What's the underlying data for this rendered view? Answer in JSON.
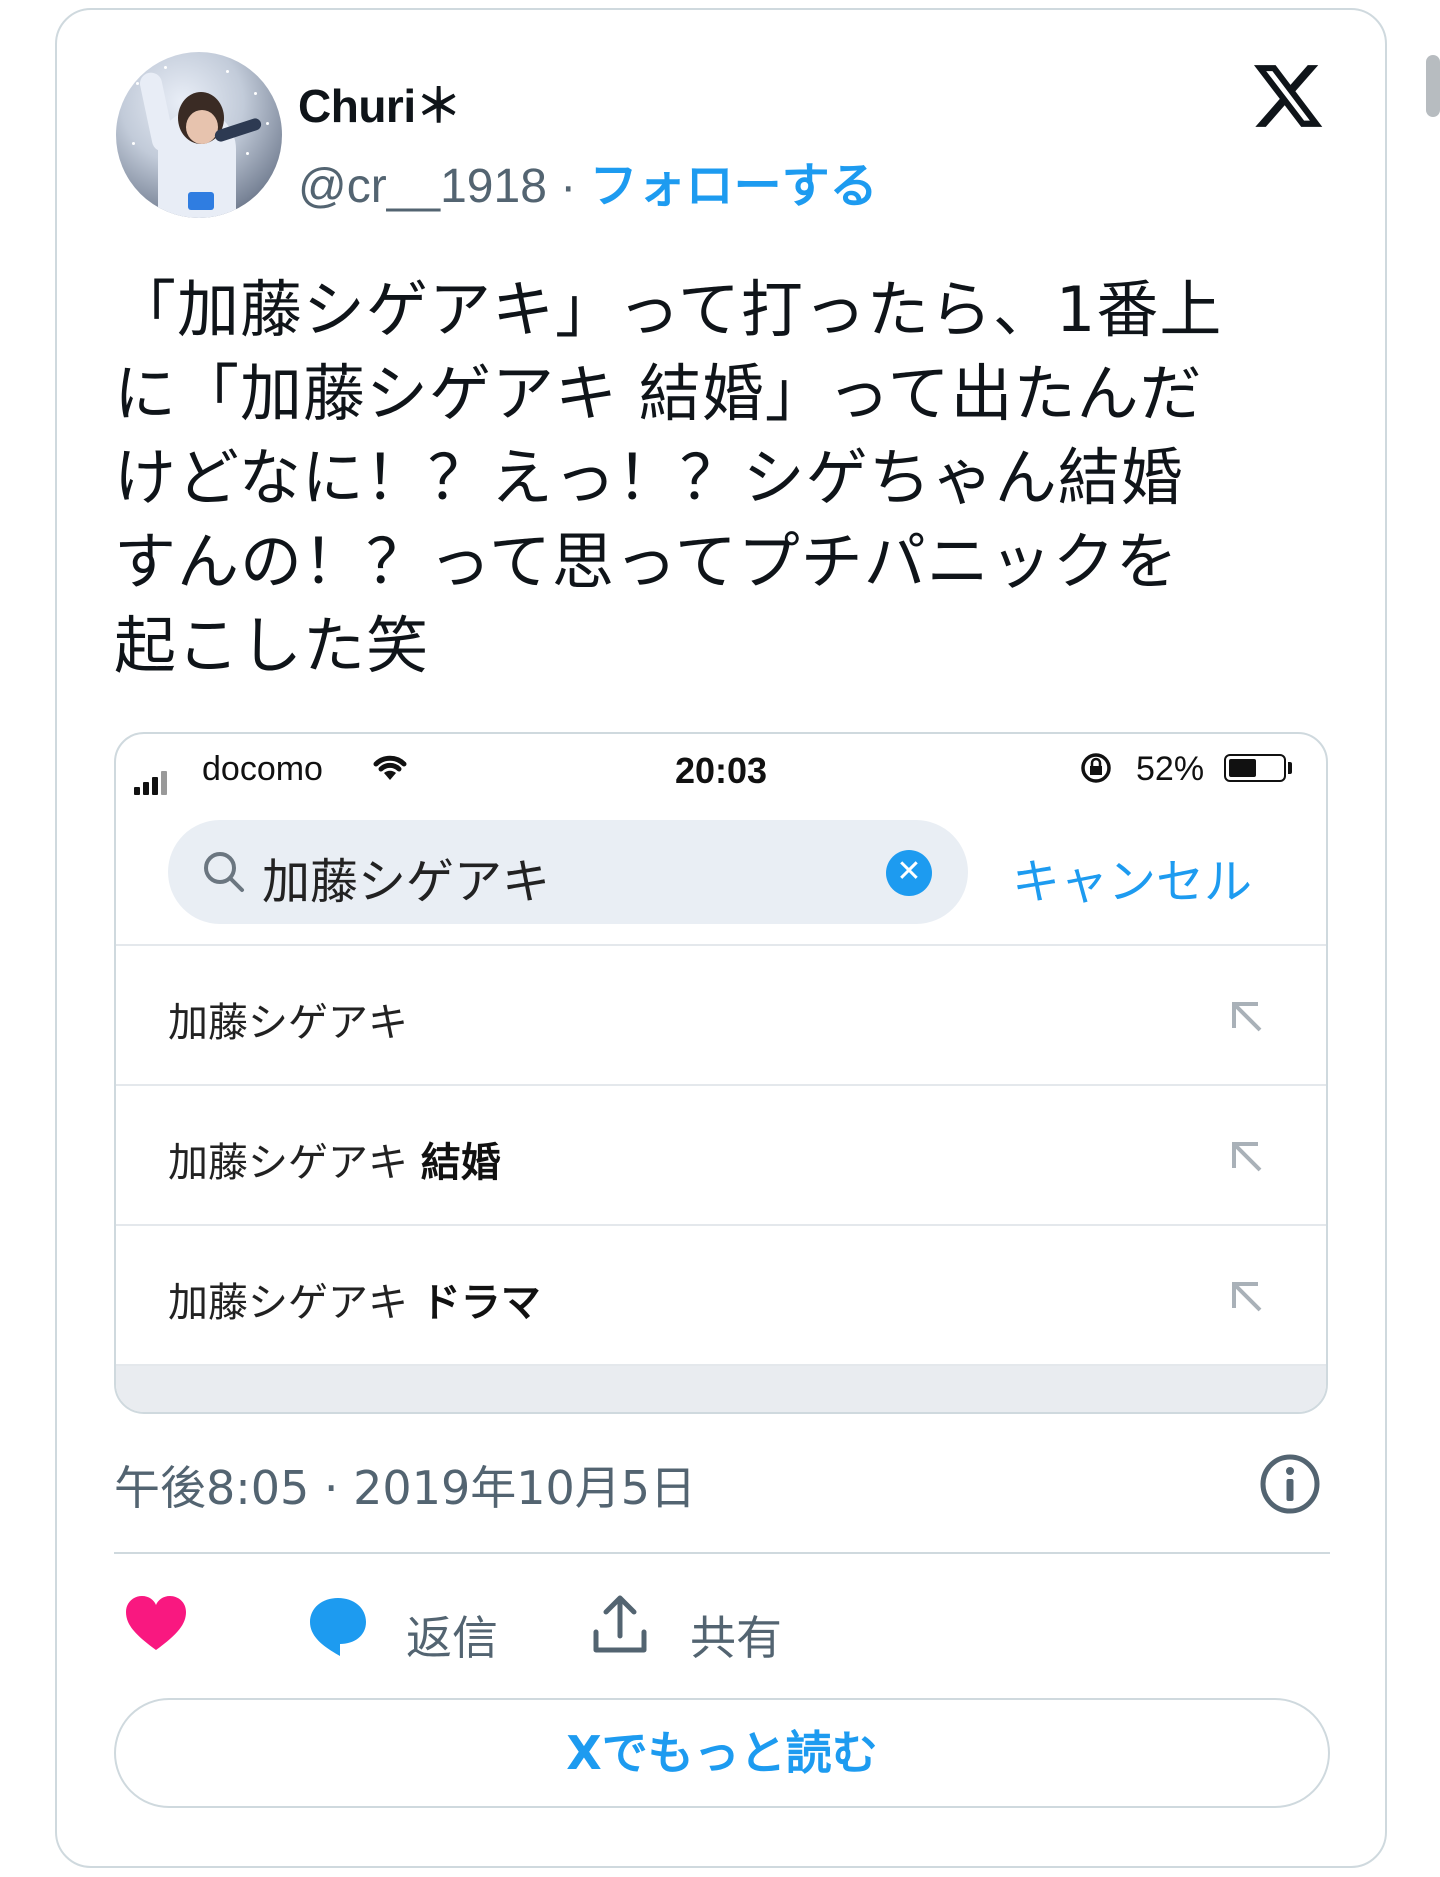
{
  "author": {
    "display_name": "Churi＊",
    "handle": "@cr__1918",
    "separator": "·",
    "follow_label": "フォローする"
  },
  "brand_icon": "x-logo-icon",
  "tweet": {
    "lines": [
      "「加藤シゲアキ」って打ったら、1番上",
      "に「加藤シゲアキ 結婚」って出たんだ",
      "けどなに！？えっ！？シゲちゃん結婚",
      "すんの！？って思ってプチパニックを",
      "起こした笑"
    ]
  },
  "screenshot": {
    "status_bar": {
      "carrier": "docomo",
      "time": "20:03",
      "battery_percent_text": "52%",
      "battery_level": 0.52
    },
    "search": {
      "query": "加藤シゲアキ",
      "cancel_label": "キャンセル"
    },
    "suggestions": [
      {
        "prefix": "加藤シゲアキ",
        "bold": ""
      },
      {
        "prefix": "加藤シゲアキ ",
        "bold": "結婚"
      },
      {
        "prefix": "加藤シゲアキ ",
        "bold": "ドラマ"
      }
    ]
  },
  "meta": {
    "timestamp": "午後8:05 · 2019年10月5日"
  },
  "actions": {
    "like_label": "",
    "reply_label": "返信",
    "share_label": "共有"
  },
  "read_more_label": "Xでもっと読む",
  "colors": {
    "accent": "#1d9bf0",
    "like": "#f91880",
    "muted": "#536471",
    "border": "#cfd9de"
  }
}
